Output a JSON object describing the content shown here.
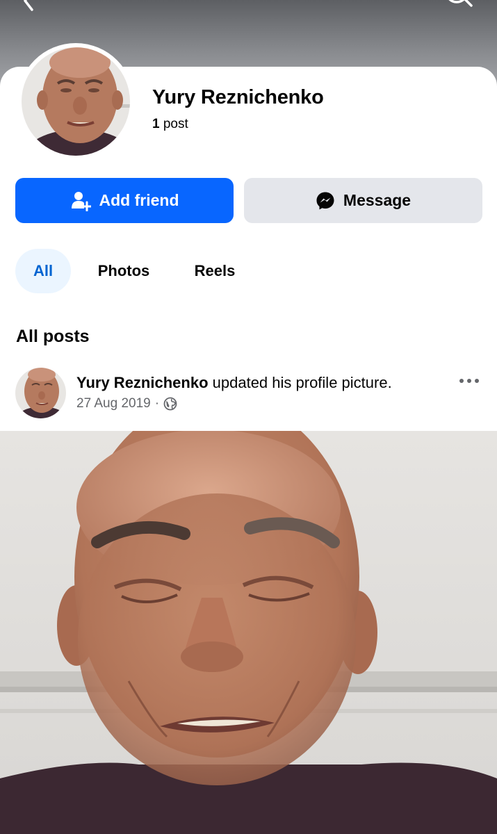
{
  "profile": {
    "name": "Yury Reznichenko",
    "post_count": "1",
    "post_count_label": "post"
  },
  "actions": {
    "add_friend_label": "Add friend",
    "message_label": "Message"
  },
  "tabs": [
    {
      "label": "All",
      "selected": true
    },
    {
      "label": "Photos",
      "selected": false
    },
    {
      "label": "Reels",
      "selected": false
    }
  ],
  "section": {
    "title": "All posts"
  },
  "post": {
    "author": "Yury Reznichenko",
    "action_text": "updated his profile picture.",
    "date": "27 Aug 2019",
    "separator": "·",
    "audience_icon": "globe-icon"
  },
  "icons": {
    "back": "back-arrow-icon",
    "search": "search-icon",
    "add_friend": "add-friend-icon",
    "message": "messenger-icon",
    "more": "more-options-icon"
  },
  "colors": {
    "primary": "#0866ff",
    "secondary_button": "#e4e6eb",
    "selected_tab_bg": "#ebf5ff",
    "selected_tab_text": "#0064d1",
    "muted_text": "#65676b"
  }
}
